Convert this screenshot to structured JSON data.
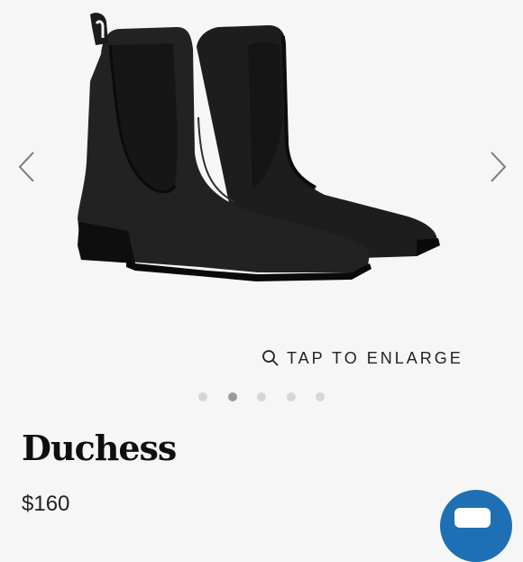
{
  "gallery": {
    "enlarge_label": "TAP TO ENLARGE",
    "image_count": 5,
    "active_index": 1
  },
  "product": {
    "name": "Duchess",
    "price": "$160"
  },
  "icons": {
    "prev": "chevron-left-icon",
    "next": "chevron-right-icon",
    "enlarge": "search-icon",
    "chat": "chat-icon"
  },
  "colors": {
    "background": "#f6f6f6",
    "dot_inactive": "#d6d6d6",
    "dot_active": "#9a9a9a",
    "chat_button": "#1f6fb5"
  }
}
